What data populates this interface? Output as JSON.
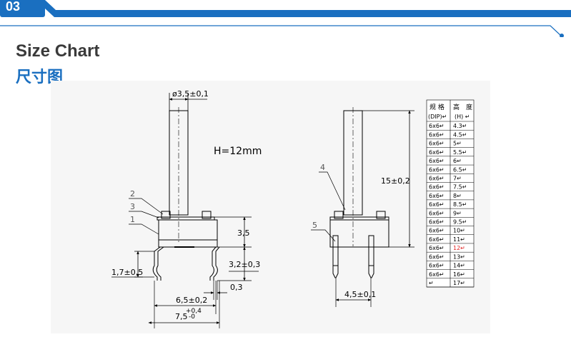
{
  "section": {
    "number": "03"
  },
  "headings": {
    "title_en": "Size Chart",
    "title_zh": "尺寸图"
  },
  "colors": {
    "banner": "#1a6fc0",
    "highlight": "#e02020"
  },
  "left_view": {
    "diameter": "ø3,5±0,1",
    "height_note": "H=12mm",
    "callout_1": "1",
    "callout_2": "2",
    "callout_3": "3",
    "dim_3_5": "3,5",
    "dim_3_2": "3,2±0,3",
    "dim_1_7": "1,7±0,5",
    "dim_0_3": "0,3",
    "dim_6_5": "6,5±0,2",
    "dim_7_5": "7,5",
    "tol_plus": "+0,4",
    "tol_minus": "-0"
  },
  "right_view": {
    "dim_15": "15±0,2",
    "callout_4": "4",
    "callout_5": "5",
    "dim_4_5": "4,5±0,1"
  },
  "spec_table": {
    "header_col1_line1": "规 格",
    "header_col1_line2": "(DIP)↵",
    "header_col2_line1": "高　度",
    "header_col2_line2": "(H) ↵",
    "rows": [
      {
        "spec": "6x6↵",
        "height": "4.3↵"
      },
      {
        "spec": "6x6↵",
        "height": "4.5↵"
      },
      {
        "spec": "6x6↵",
        "height": "5↵"
      },
      {
        "spec": "6x6↵",
        "height": "5.5↵"
      },
      {
        "spec": "6x6↵",
        "height": "6↵"
      },
      {
        "spec": "6x6↵",
        "height": "6.5↵"
      },
      {
        "spec": "6x6↵",
        "height": "7↵"
      },
      {
        "spec": "6x6↵",
        "height": "7.5↵"
      },
      {
        "spec": "6x6↵",
        "height": "8↵"
      },
      {
        "spec": "6x6↵",
        "height": "8.5↵"
      },
      {
        "spec": "6x6↵",
        "height": "9↵"
      },
      {
        "spec": "6x6↵",
        "height": "9.5↵"
      },
      {
        "spec": "6x6↵",
        "height": "10↵"
      },
      {
        "spec": "6x6↵",
        "height": "11↵"
      },
      {
        "spec": "6x6↵",
        "height": "12↵",
        "highlight": true
      },
      {
        "spec": "6x6↵",
        "height": "13↵"
      },
      {
        "spec": "6x6↵",
        "height": "14↵"
      },
      {
        "spec": "6x6↵",
        "height": "16↵"
      },
      {
        "spec": "↵",
        "height": "17↵"
      }
    ]
  }
}
